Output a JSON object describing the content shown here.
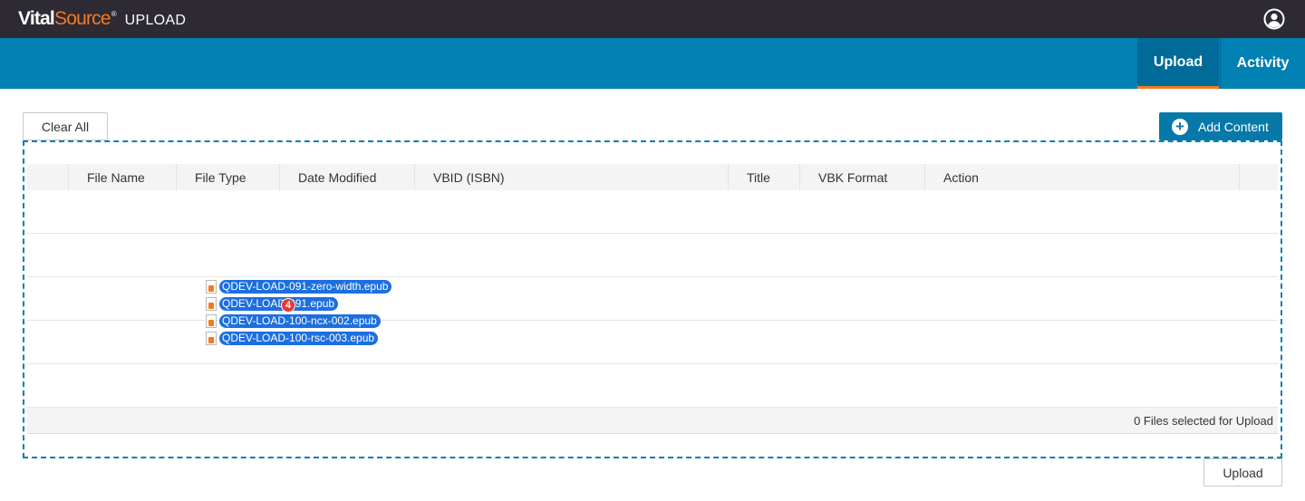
{
  "header": {
    "brand_vital": "Vital",
    "brand_source": "Source",
    "brand_tm": "®",
    "app_name": "UPLOAD",
    "user_icon": "user-circle-icon"
  },
  "nav": {
    "tabs": [
      {
        "label": "Upload",
        "active": true
      },
      {
        "label": "Activity",
        "active": false
      }
    ]
  },
  "toolbar": {
    "clear_all_label": "Clear All",
    "add_content_label": "Add Content"
  },
  "table": {
    "columns": [
      "",
      "File Name",
      "File Type",
      "Date Modified",
      "VBID (ISBN)",
      "Title",
      "VBK Format",
      "Action"
    ],
    "footer_text": "0 Files selected for Upload"
  },
  "drag": {
    "files": [
      "QDEV-LOAD-091-zero-width.epub",
      "QDEV-LOAD-091.epub",
      "QDEV-LOAD-100-ncx-002.epub",
      "QDEV-LOAD-100-rsc-003.epub"
    ],
    "count": "4"
  },
  "upload_label": "Upload",
  "colors": {
    "topbar": "#2d2a34",
    "navbar": "#0080b3",
    "accent": "#f47b20",
    "primary_button": "#0779a8",
    "drag_label": "#1c6fe0",
    "badge": "#e53935"
  }
}
